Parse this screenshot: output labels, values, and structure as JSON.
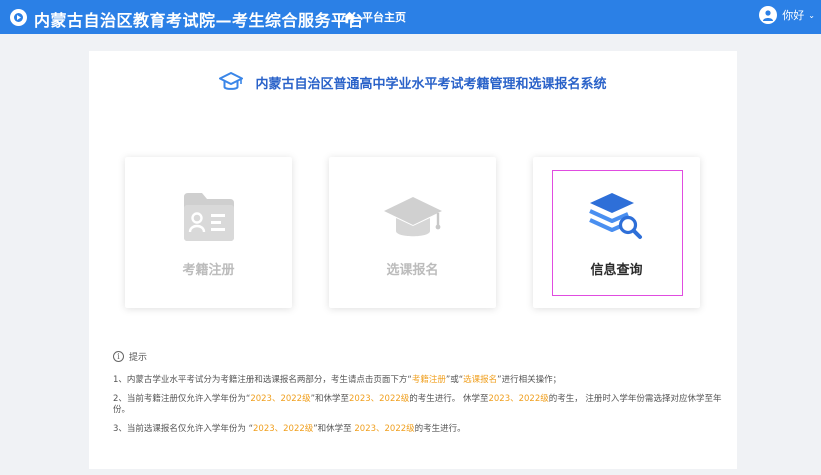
{
  "header": {
    "title": "内蒙古自治区教育考试院—考生综合服务平台",
    "home_label": "平台主页",
    "user_greeting": "你好"
  },
  "main": {
    "system_title": "内蒙古自治区普通高中学业水平考试考籍管理和选课报名系统",
    "cards": [
      {
        "label": "考籍注册",
        "icon": "folder-id-icon",
        "state": "disabled"
      },
      {
        "label": "选课报名",
        "icon": "graduation-cap-icon",
        "state": "disabled"
      },
      {
        "label": "信息查询",
        "icon": "layers-search-icon",
        "state": "active"
      }
    ]
  },
  "notice": {
    "title": "提示",
    "line1": {
      "a": "1、内蒙古学业水平考试分为考籍注册和选课报名两部分，考生请点击页面下方“",
      "b": "考籍注册",
      "c": "”或“",
      "d": "选课报名",
      "e": "”进行相关操作；"
    },
    "line2": {
      "a": "2、当前考籍注册仅允许入学年份为“",
      "b": "2023、2022级",
      "c": "”和休学至",
      "d": "2023、2022级",
      "e": "的考生进行。 休学至",
      "f": "2023、2022级",
      "g": "的考生， 注册时入学年份需选择对应休学至年份。"
    },
    "line3": {
      "a": "3、当前选课报名仅允许入学年份为 “",
      "b": "2023、2022级",
      "c": "”和休学至 ",
      "d": "2023、2022级",
      "e": "的考生进行。"
    }
  },
  "colors": {
    "header_bg": "#2b80e6",
    "title_blue": "#2a62c9",
    "highlight_orange": "#f0a020",
    "active_border": "#e04ce0"
  }
}
